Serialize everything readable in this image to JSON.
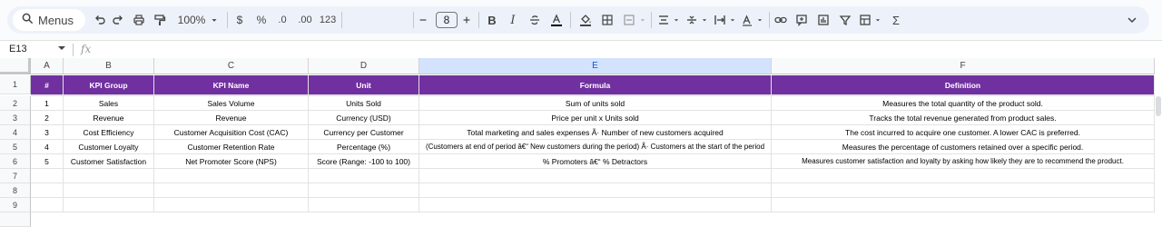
{
  "toolbar": {
    "search_label": "Menus",
    "zoom": "100%",
    "currency": "$",
    "percent": "%",
    "dec_decrease": ".0",
    "dec_increase": ".00",
    "format_123": "123",
    "font_size": "8"
  },
  "formula_bar": {
    "cell_ref": "E13",
    "fx": "fx",
    "content": ""
  },
  "columns": [
    "A",
    "B",
    "C",
    "D",
    "E",
    "F"
  ],
  "selected_column": "E",
  "row_numbers": [
    "1",
    "2",
    "3",
    "4",
    "5",
    "6",
    "7",
    "8",
    "9"
  ],
  "header_row": [
    "#",
    "KPI Group",
    "KPI Name",
    "Unit",
    "Formula",
    "Definition"
  ],
  "rows": [
    [
      "1",
      "Sales",
      "Sales Volume",
      "Units Sold",
      "Sum of units sold",
      "Measures the total quantity of the product sold."
    ],
    [
      "2",
      "Revenue",
      "Revenue",
      "Currency (USD)",
      "Price per unit x Units sold",
      "Tracks the total revenue generated from product sales."
    ],
    [
      "3",
      "Cost Efficiency",
      "Customer Acquisition Cost (CAC)",
      "Currency per Customer",
      "Total marketing and sales expenses Ã· Number of new customers acquired",
      "The cost incurred to acquire one customer. A lower CAC is preferred."
    ],
    [
      "4",
      "Customer Loyalty",
      "Customer Retention Rate",
      "Percentage (%)",
      "(Customers at end of period â€“ New customers during the period) Ã· Customers at the start of the period",
      "Measures the percentage of customers retained over a specific period."
    ],
    [
      "5",
      "Customer Satisfaction",
      "Net Promoter Score (NPS)",
      "Score (Range: -100 to 100)",
      "% Promoters â€“ % Detractors",
      "Measures customer satisfaction and loyalty by asking how likely they are to recommend the product."
    ]
  ],
  "colors": {
    "header_fill": "#7030a0",
    "selected_column": "#d3e3fd"
  }
}
